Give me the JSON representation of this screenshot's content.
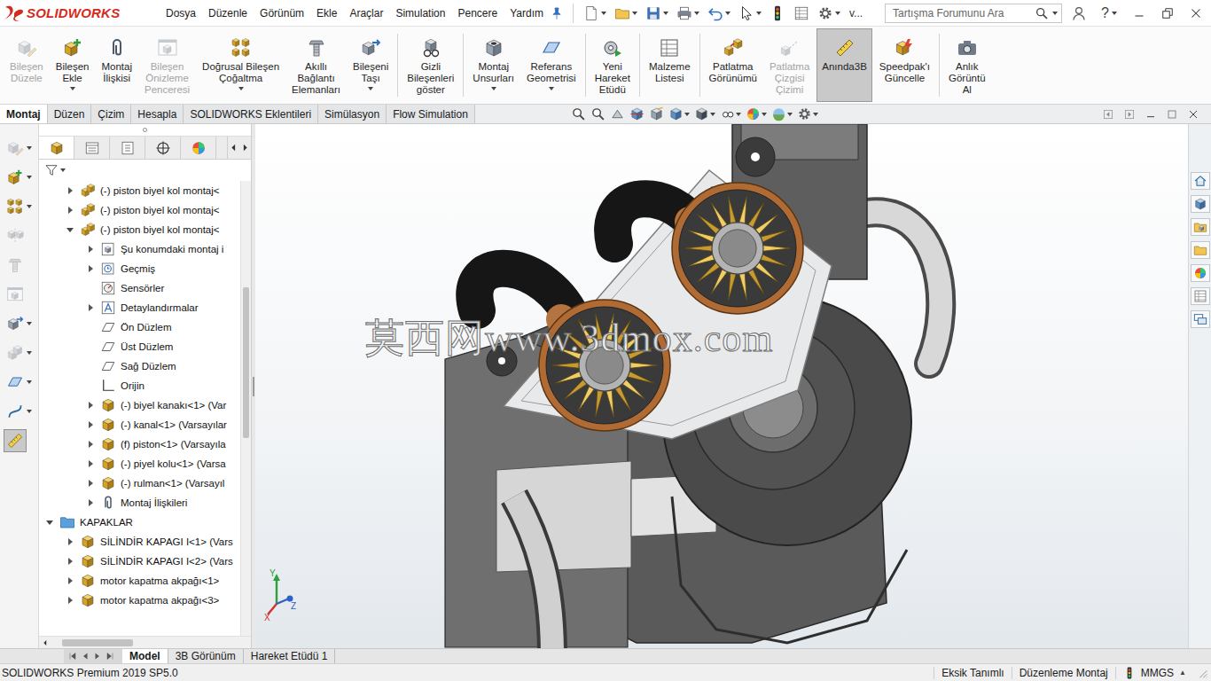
{
  "app": {
    "logo": "SOLIDWORKS"
  },
  "menu": [
    "Dosya",
    "Düzenle",
    "Görünüm",
    "Ekle",
    "Araçlar",
    "Simulation",
    "Pencere",
    "Yardım"
  ],
  "quick_access": [
    {
      "kind": "new",
      "dropdown": true
    },
    {
      "kind": "open",
      "dropdown": true
    },
    {
      "kind": "save",
      "dropdown": true
    },
    {
      "kind": "print",
      "dropdown": true
    },
    {
      "kind": "undo",
      "dropdown": true
    },
    {
      "kind": "select",
      "dropdown": true
    },
    {
      "kind": "rebuild",
      "dropdown": false
    },
    {
      "kind": "file-properties",
      "dropdown": false
    },
    {
      "kind": "options",
      "dropdown": true
    }
  ],
  "quick_access_overflow": "v...",
  "search": {
    "placeholder": "Tartışma Forumunu Ara"
  },
  "help": "?",
  "ribbon": [
    {
      "lines": [
        "Bileşen",
        "Düzele"
      ],
      "kind": "edit-component",
      "disabled": true,
      "selected": false,
      "dropdown": false,
      "separator_after": false
    },
    {
      "lines": [
        "Bileşen",
        "Ekle"
      ],
      "kind": "insert-component",
      "disabled": false,
      "selected": false,
      "dropdown": true,
      "separator_after": false
    },
    {
      "lines": [
        "Montaj",
        "İlişkisi"
      ],
      "kind": "mate",
      "disabled": false,
      "selected": false,
      "dropdown": false,
      "separator_after": false
    },
    {
      "lines": [
        "Bileşen",
        "Önizleme",
        "Penceresi"
      ],
      "kind": "preview",
      "disabled": true,
      "selected": false,
      "dropdown": false,
      "separator_after": false
    },
    {
      "lines": [
        "Doğrusal Bileşen",
        "Çoğaltma"
      ],
      "kind": "pattern",
      "disabled": false,
      "selected": false,
      "dropdown": true,
      "separator_after": false
    },
    {
      "lines": [
        "Akıllı",
        "Bağlantı",
        "Elemanları"
      ],
      "kind": "fastener",
      "disabled": false,
      "selected": false,
      "dropdown": false,
      "separator_after": false
    },
    {
      "lines": [
        "Bileşeni",
        "Taşı"
      ],
      "kind": "move",
      "disabled": false,
      "selected": false,
      "dropdown": true,
      "separator_after": true
    },
    {
      "lines": [
        "Gizli",
        "Bileşenleri",
        "göster"
      ],
      "kind": "show-hidden",
      "disabled": false,
      "selected": false,
      "dropdown": false,
      "separator_after": true
    },
    {
      "lines": [
        "Montaj",
        "Unsurları"
      ],
      "kind": "assembly-features",
      "disabled": false,
      "selected": false,
      "dropdown": true,
      "separator_after": false
    },
    {
      "lines": [
        "Referans",
        "Geometrisi"
      ],
      "kind": "reference",
      "disabled": false,
      "selected": false,
      "dropdown": true,
      "separator_after": true
    },
    {
      "lines": [
        "Yeni",
        "Hareket",
        "Etüdü"
      ],
      "kind": "motion",
      "disabled": false,
      "selected": false,
      "dropdown": false,
      "separator_after": true
    },
    {
      "lines": [
        "Malzeme",
        "Listesi"
      ],
      "kind": "bom",
      "disabled": false,
      "selected": false,
      "dropdown": false,
      "separator_after": true
    },
    {
      "lines": [
        "Patlatma",
        "Görünümü"
      ],
      "kind": "explode",
      "disabled": false,
      "selected": false,
      "dropdown": false,
      "separator_after": false
    },
    {
      "lines": [
        "Patlatma",
        "Çizgisi",
        "Çizimi"
      ],
      "kind": "explode-line",
      "disabled": true,
      "selected": false,
      "dropdown": false,
      "separator_after": false
    },
    {
      "lines": [
        "Anında3B"
      ],
      "kind": "instant3d",
      "disabled": false,
      "selected": true,
      "dropdown": false,
      "separator_after": false
    },
    {
      "lines": [
        "Speedpak'ı",
        "Güncelle"
      ],
      "kind": "speedpak",
      "disabled": false,
      "selected": false,
      "dropdown": false,
      "separator_after": true
    },
    {
      "lines": [
        "Anlık",
        "Görüntü",
        "Al"
      ],
      "kind": "snapshot",
      "disabled": false,
      "selected": false,
      "dropdown": false,
      "separator_after": false
    }
  ],
  "command_tabs": [
    {
      "label": "Montaj",
      "selected": true
    },
    {
      "label": "Düzen",
      "selected": false
    },
    {
      "label": "Çizim",
      "selected": false
    },
    {
      "label": "Hesapla",
      "selected": false
    },
    {
      "label": "SOLIDWORKS Eklentileri",
      "selected": false
    },
    {
      "label": "Simülasyon",
      "selected": false
    },
    {
      "label": "Flow Simulation",
      "selected": false
    }
  ],
  "hud_toolbar": [
    {
      "kind": "zoom-fit",
      "dropdown": false
    },
    {
      "kind": "zoom-area",
      "dropdown": false
    },
    {
      "kind": "previous-view",
      "dropdown": false
    },
    {
      "kind": "section",
      "dropdown": false
    },
    {
      "kind": "dynamic-annotation",
      "dropdown": false
    },
    {
      "kind": "view-orientation",
      "dropdown": true
    },
    {
      "kind": "display-style",
      "dropdown": true
    },
    {
      "kind": "hide-show",
      "dropdown": true
    },
    {
      "kind": "edit-appearance",
      "dropdown": true
    },
    {
      "kind": "scene",
      "dropdown": true
    },
    {
      "kind": "view-settings",
      "dropdown": true
    }
  ],
  "left_toolbar": [
    {
      "kind": "component-edit",
      "disabled": true,
      "selected": false,
      "dropdown": true
    },
    {
      "kind": "insert",
      "disabled": false,
      "selected": false,
      "dropdown": true
    },
    {
      "kind": "pattern",
      "disabled": false,
      "selected": false,
      "dropdown": true
    },
    {
      "kind": "mirror",
      "disabled": true,
      "selected": false,
      "dropdown": false
    },
    {
      "kind": "smart",
      "disabled": true,
      "selected": false,
      "dropdown": false
    },
    {
      "kind": "preview",
      "disabled": true,
      "selected": false,
      "dropdown": false
    },
    {
      "kind": "move",
      "disabled": false,
      "selected": false,
      "dropdown": true
    },
    {
      "kind": "copy",
      "disabled": true,
      "selected": false,
      "dropdown": true
    },
    {
      "kind": "reference",
      "disabled": false,
      "selected": false,
      "dropdown": true
    },
    {
      "kind": "curve",
      "disabled": false,
      "selected": false,
      "dropdown": true
    },
    {
      "kind": "instant3d",
      "disabled": false,
      "selected": true,
      "dropdown": false
    }
  ],
  "tree_tabs": [
    {
      "kind": "feature-manager",
      "selected": true
    },
    {
      "kind": "property-manager",
      "selected": false
    },
    {
      "kind": "configuration-manager",
      "selected": false
    },
    {
      "kind": "dimxpert",
      "selected": false
    },
    {
      "kind": "display-manager",
      "selected": false
    }
  ],
  "tree": [
    {
      "label": "(-) piston biyel kol montaj<",
      "kind": "assembly",
      "depth": 1,
      "expandable": true,
      "expanded": false
    },
    {
      "label": "(-) piston biyel kol montaj<",
      "kind": "assembly",
      "depth": 1,
      "expandable": true,
      "expanded": false
    },
    {
      "label": "(-) piston biyel kol montaj<",
      "kind": "assembly",
      "depth": 1,
      "expandable": true,
      "expanded": true
    },
    {
      "label": "Şu konumdaki montaj i",
      "kind": "document",
      "depth": 2,
      "expandable": true,
      "expanded": false
    },
    {
      "label": "Geçmiş",
      "kind": "history",
      "depth": 2,
      "expandable": true,
      "expanded": false
    },
    {
      "label": "Sensörler",
      "kind": "sensor",
      "depth": 2,
      "expandable": false,
      "expanded": false
    },
    {
      "label": "Detaylandırmalar",
      "kind": "annotation",
      "depth": 2,
      "expandable": true,
      "expanded": false
    },
    {
      "label": "Ön Düzlem",
      "kind": "plane",
      "depth": 2,
      "expandable": false,
      "expanded": false
    },
    {
      "label": "Üst Düzlem",
      "kind": "plane",
      "depth": 2,
      "expandable": false,
      "expanded": false
    },
    {
      "label": "Sağ Düzlem",
      "kind": "plane",
      "depth": 2,
      "expandable": false,
      "expanded": false
    },
    {
      "label": "Orijin",
      "kind": "origin",
      "depth": 2,
      "expandable": false,
      "expanded": false
    },
    {
      "label": "(-) biyel kanakı<1> (Var",
      "kind": "part",
      "depth": 2,
      "expandable": true,
      "expanded": false
    },
    {
      "label": "(-) kanal<1> (Varsayılar",
      "kind": "part",
      "depth": 2,
      "expandable": true,
      "expanded": false
    },
    {
      "label": "(f) piston<1> (Varsayıla",
      "kind": "part",
      "depth": 2,
      "expandable": true,
      "expanded": false
    },
    {
      "label": "(-) piyel kolu<1> (Varsa",
      "kind": "part",
      "depth": 2,
      "expandable": true,
      "expanded": false
    },
    {
      "label": "(-) rulman<1> (Varsayıl",
      "kind": "part",
      "depth": 2,
      "expandable": true,
      "expanded": false
    },
    {
      "label": "Montaj İlişkileri",
      "kind": "mates",
      "depth": 2,
      "expandable": true,
      "expanded": false
    },
    {
      "label": "KAPAKLAR",
      "kind": "folder",
      "depth": 0,
      "expandable": true,
      "expanded": true
    },
    {
      "label": "SİLİNDİR KAPAGI I<1> (Vars",
      "kind": "part",
      "depth": 1,
      "expandable": true,
      "expanded": false
    },
    {
      "label": "SİLİNDİR KAPAGI I<2> (Vars",
      "kind": "part",
      "depth": 1,
      "expandable": true,
      "expanded": false
    },
    {
      "label": "motor kapatma akpağı<1>",
      "kind": "part",
      "depth": 1,
      "expandable": true,
      "expanded": false
    },
    {
      "label": "motor kapatma akpağı<3>",
      "kind": "part",
      "depth": 1,
      "expandable": true,
      "expanded": false
    }
  ],
  "viewport": {
    "watermark": "莫西网www.3dmox.com",
    "axes": {
      "x": "X",
      "y": "Y",
      "z": "Z"
    }
  },
  "task_pane": [
    {
      "kind": "home"
    },
    {
      "kind": "resources"
    },
    {
      "kind": "design-library"
    },
    {
      "kind": "file-explorer"
    },
    {
      "kind": "appearances"
    },
    {
      "kind": "custom-properties"
    },
    {
      "kind": "forum"
    }
  ],
  "bottom_tabs": [
    {
      "label": "Model",
      "selected": true
    },
    {
      "label": "3B Görünüm",
      "selected": false
    },
    {
      "label": "Hareket Etüdü 1",
      "selected": false
    }
  ],
  "status_bar": {
    "product": "SOLIDWORKS Premium 2019 SP5.0",
    "items": [
      "Eksik Tanımlı",
      "Düzenleme Montaj"
    ],
    "units": "MMGS",
    "units_arrow": "▲"
  }
}
